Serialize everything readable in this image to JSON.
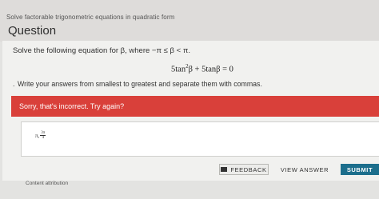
{
  "header": {
    "breadcrumb": "Solve factorable trigonometric equations in quadratic form",
    "title": "Question"
  },
  "question": {
    "prompt_text": "Solve the following equation for β, where −π ≤ β < π.",
    "equation_part1": "5tan",
    "equation_exp": "2",
    "equation_part2": "β + 5tanβ = 0",
    "instruction": "Write your answers from smallest to greatest and separate them with commas."
  },
  "feedback": {
    "message": "Sorry, that's incorrect. Try again?",
    "color": "#d9403a"
  },
  "answer": {
    "prefix": "π,",
    "frac_num": "3π",
    "frac_den": "4"
  },
  "buttons": {
    "feedback_label": "FEEDBACK",
    "feedback_icon": "flag-icon",
    "view_answer_label": "VIEW ANSWER",
    "submit_label": "SUBMIT",
    "submit_color": "#1c6e8c"
  },
  "footer": {
    "attribution": "Content attribution"
  }
}
